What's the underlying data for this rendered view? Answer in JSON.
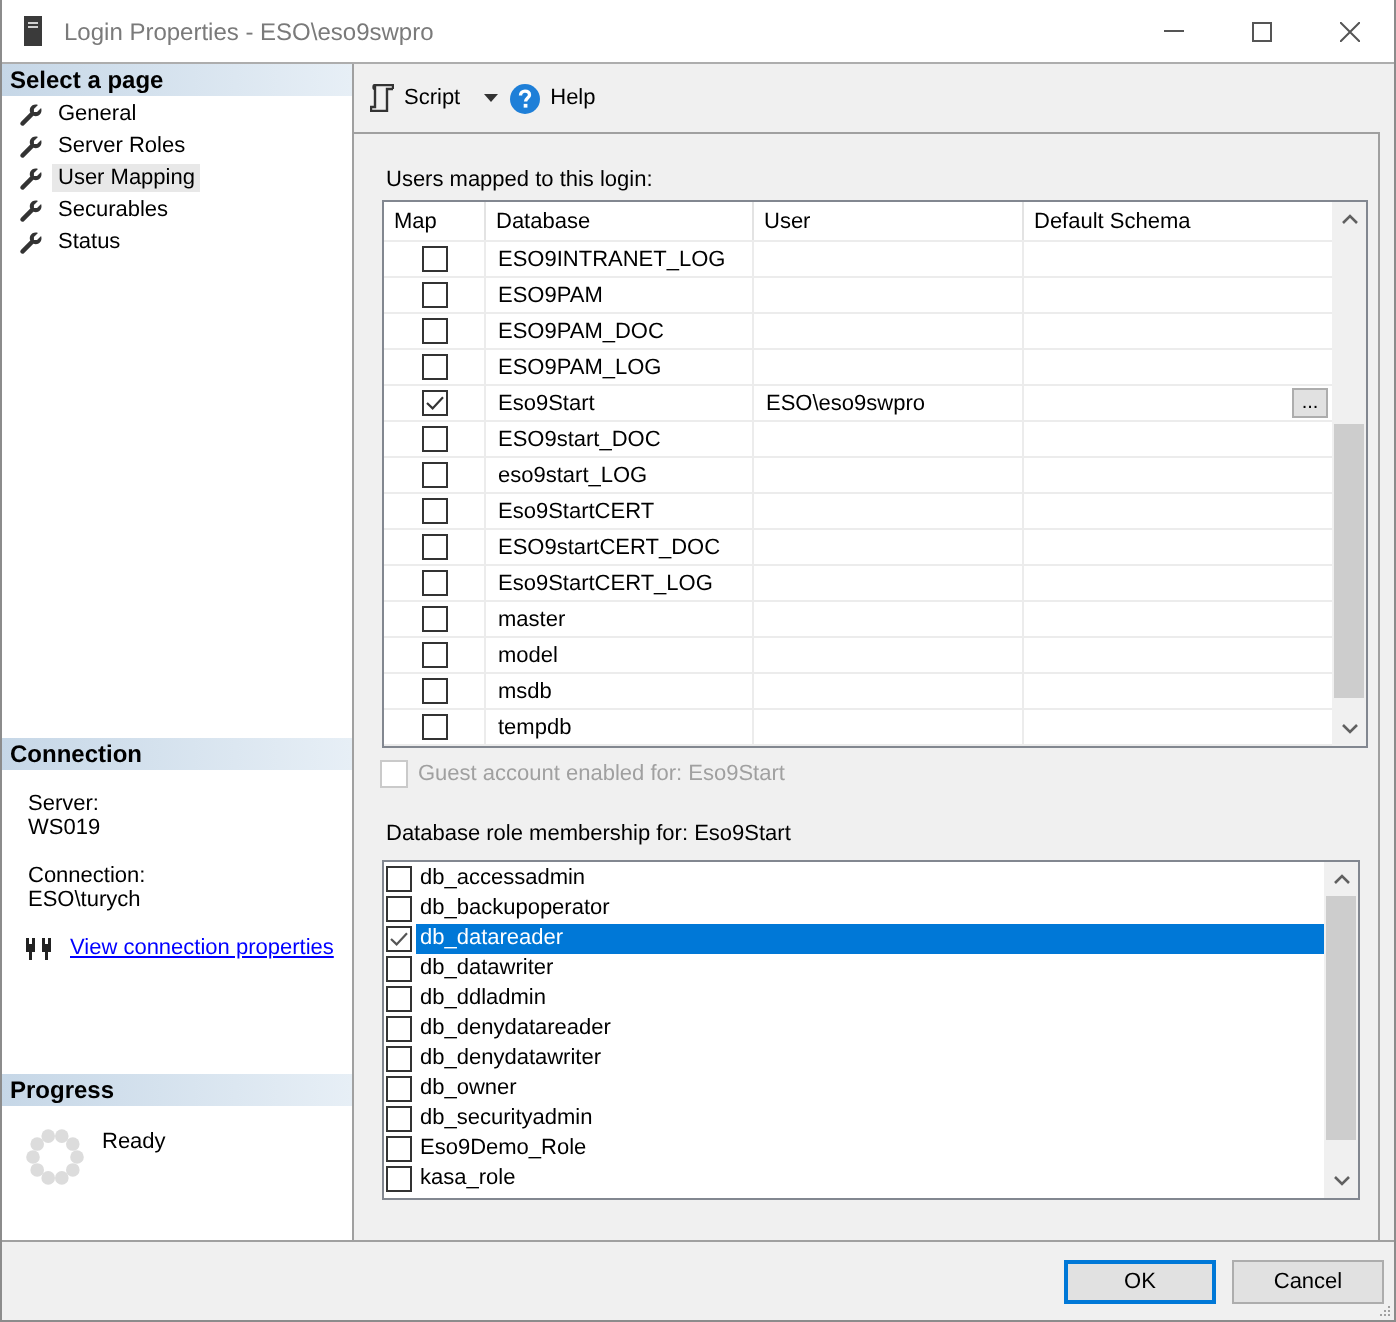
{
  "window": {
    "title": "Login Properties - ESO\\eso9swpro"
  },
  "sidebar": {
    "heading": "Select a page",
    "items": [
      {
        "label": "General",
        "selected": false
      },
      {
        "label": "Server Roles",
        "selected": false
      },
      {
        "label": "User Mapping",
        "selected": true
      },
      {
        "label": "Securables",
        "selected": false
      },
      {
        "label": "Status",
        "selected": false
      }
    ]
  },
  "connection": {
    "heading": "Connection",
    "fields": [
      {
        "label": "Server:",
        "value": "WS019"
      },
      {
        "label": "Connection:",
        "value": "ESO\\turych"
      }
    ],
    "link": "View connection properties"
  },
  "progress": {
    "heading": "Progress",
    "status": "Ready"
  },
  "toolbar": {
    "script": "Script",
    "help": "Help"
  },
  "user_mapping": {
    "label": "Users mapped to this login:",
    "columns": [
      "Map",
      "Database",
      "User",
      "Default Schema"
    ],
    "rows": [
      {
        "checked": false,
        "database": "ESO9INTRANET_LOG"
      },
      {
        "checked": false,
        "database": "ESO9PAM"
      },
      {
        "checked": false,
        "database": "ESO9PAM_DOC"
      },
      {
        "checked": false,
        "database": "ESO9PAM_LOG"
      },
      {
        "checked": true,
        "database": "Eso9Start",
        "user": "ESO\\eso9swpro",
        "schema_button": "..."
      },
      {
        "checked": false,
        "database": "ESO9start_DOC"
      },
      {
        "checked": false,
        "database": "eso9start_LOG"
      },
      {
        "checked": false,
        "database": "Eso9StartCERT"
      },
      {
        "checked": false,
        "database": "ESO9startCERT_DOC"
      },
      {
        "checked": false,
        "database": "Eso9StartCERT_LOG"
      },
      {
        "checked": false,
        "database": "master"
      },
      {
        "checked": false,
        "database": "model"
      },
      {
        "checked": false,
        "database": "msdb"
      },
      {
        "checked": false,
        "database": "tempdb"
      }
    ]
  },
  "guest": {
    "label": "Guest account enabled for: Eso9Start",
    "checked": false,
    "disabled": true
  },
  "roles": {
    "label": "Database role membership for: Eso9Start",
    "items": [
      {
        "name": "db_accessadmin",
        "checked": false,
        "selected": false
      },
      {
        "name": "db_backupoperator",
        "checked": false,
        "selected": false
      },
      {
        "name": "db_datareader",
        "checked": true,
        "selected": true
      },
      {
        "name": "db_datawriter",
        "checked": false,
        "selected": false
      },
      {
        "name": "db_ddladmin",
        "checked": false,
        "selected": false
      },
      {
        "name": "db_denydatareader",
        "checked": false,
        "selected": false
      },
      {
        "name": "db_denydatawriter",
        "checked": false,
        "selected": false
      },
      {
        "name": "db_owner",
        "checked": false,
        "selected": false
      },
      {
        "name": "db_securityadmin",
        "checked": false,
        "selected": false
      },
      {
        "name": "Eso9Demo_Role",
        "checked": false,
        "selected": false
      },
      {
        "name": "kasa_role",
        "checked": false,
        "selected": false
      }
    ]
  },
  "buttons": [
    {
      "label": "OK",
      "focused": true
    },
    {
      "label": "Cancel",
      "focused": false
    }
  ]
}
